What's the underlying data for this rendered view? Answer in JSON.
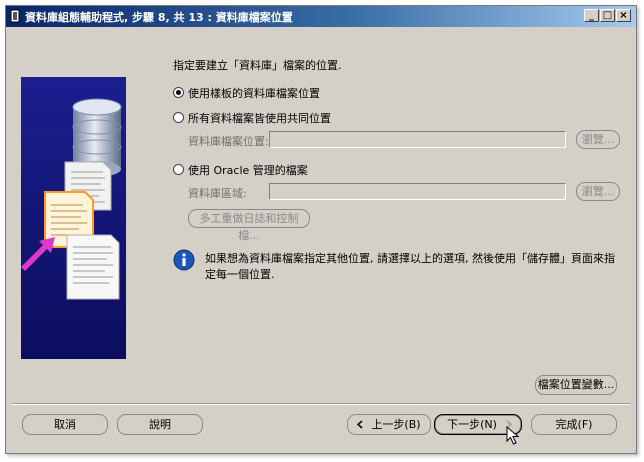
{
  "window": {
    "title": "資料庫組態輔助程式, 步驟 8, 共 13 : 資料庫檔案位置",
    "minimize_glyph": "_",
    "maximize_glyph": "□",
    "close_glyph": "×"
  },
  "main": {
    "prompt": "指定要建立「資料庫」檔案的位置.",
    "option_template": "使用樣板的資料庫檔案位置",
    "option_common": "所有資料檔案皆使用共同位置",
    "db_file_location_label": "資料庫檔案位置:",
    "db_file_location_value": "",
    "browse1_label": "瀏覽...",
    "option_oracle_managed": "使用 Oracle 管理的檔案",
    "db_area_label": "資料庫區域:",
    "db_area_value": "",
    "browse2_label": "瀏覽...",
    "multiplex_label": "多工重做日誌和控制檔...",
    "info_text": "如果想為資料庫檔案指定其他位置, 請選擇以上的選項, 然後使用「儲存體」頁面來指定每一個位置.",
    "file_location_vars_label": "檔案位置變數..."
  },
  "footer": {
    "cancel_label": "取消",
    "help_label": "說明",
    "back_label": "上一步(B)",
    "next_label": "下一步(N)",
    "finish_label": "完成(F)"
  },
  "colors": {
    "titlebar_start": "#0a246a",
    "titlebar_end": "#a6caf0",
    "dialog_bg": "#d4d0c8",
    "side_image_bg": "#12157a",
    "info_icon": "#1e55b8",
    "arrow": "#e238c9"
  }
}
